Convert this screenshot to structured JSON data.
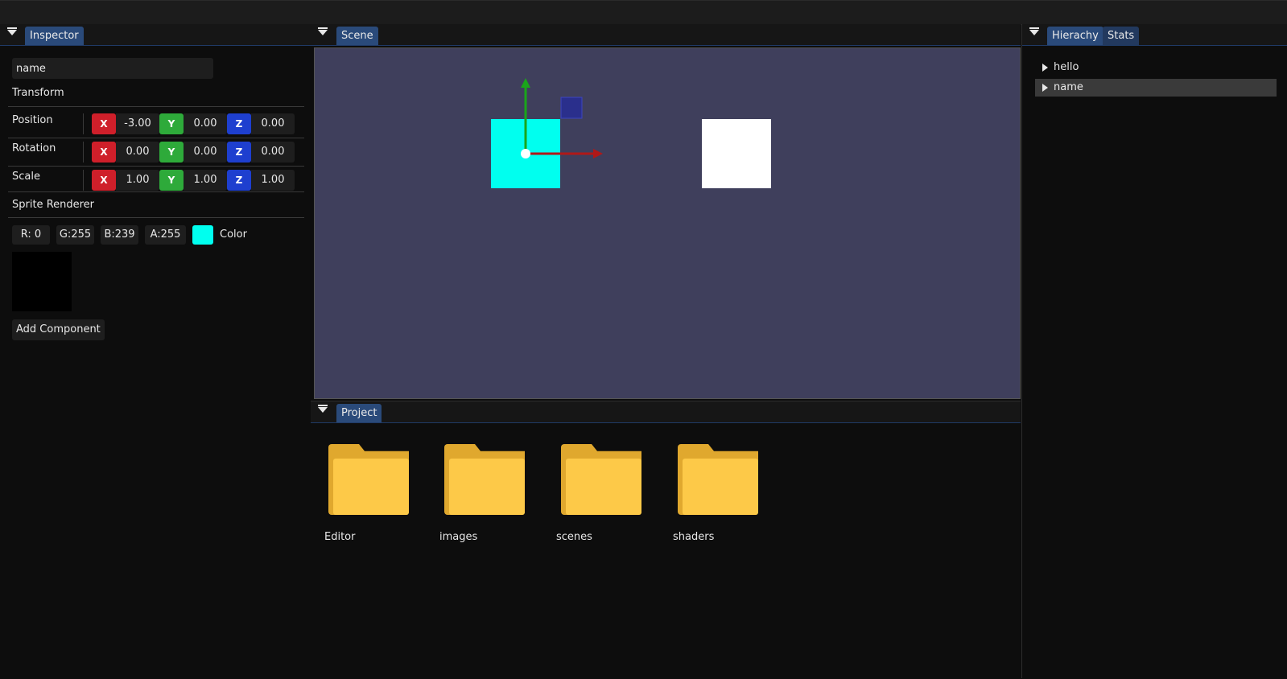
{
  "inspector": {
    "tab": "Inspector",
    "name_value": "name",
    "transform_title": "Transform",
    "rows": [
      {
        "label": "Position",
        "x": "-3.00",
        "y": "0.00",
        "z": "0.00"
      },
      {
        "label": "Rotation",
        "x": "0.00",
        "y": "0.00",
        "z": "0.00"
      },
      {
        "label": "Scale",
        "x": "1.00",
        "y": "1.00",
        "z": "1.00"
      }
    ],
    "axis_labels": {
      "x": "X",
      "y": "Y",
      "z": "Z"
    },
    "sprite_title": "Sprite Renderer",
    "color": {
      "r": "R:  0",
      "g": "G:255",
      "b": "B:239",
      "a": "A:255",
      "label": "Color",
      "hex": "#00ffef"
    },
    "add_component": "Add Component"
  },
  "scene": {
    "tab": "Scene",
    "background": "#3f3f5c",
    "selected_sprite_color": "#00ffef",
    "other_sprite_color": "#ffffff"
  },
  "project": {
    "tab": "Project",
    "folders": [
      "Editor",
      "images",
      "scenes",
      "shaders"
    ]
  },
  "hierarchy": {
    "tabs": [
      "Hierachy",
      "Stats"
    ],
    "items": [
      {
        "label": "hello",
        "selected": false
      },
      {
        "label": "name",
        "selected": true
      }
    ]
  }
}
